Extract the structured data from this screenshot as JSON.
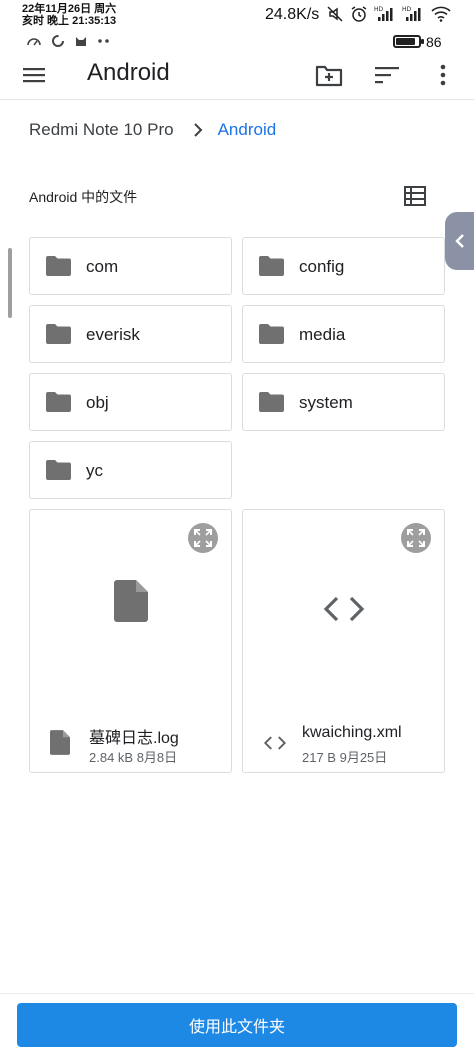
{
  "status_bar": {
    "date_line": "22年11月26日 周六",
    "time_line": "亥时 晚上 21:35:13",
    "net_speed": "24.8K/s",
    "battery_pct": "86",
    "battery_level": 0.86
  },
  "app_bar": {
    "title": "Android"
  },
  "breadcrumb": {
    "root": "Redmi Note 10 Pro",
    "current": "Android"
  },
  "section": {
    "title": "Android 中的文件"
  },
  "folders": [
    {
      "name": "com"
    },
    {
      "name": "config"
    },
    {
      "name": "everisk"
    },
    {
      "name": "media"
    },
    {
      "name": "obj"
    },
    {
      "name": "system"
    },
    {
      "name": "yc"
    }
  ],
  "files": [
    {
      "name": "墓碑日志.log",
      "info": "2.84 kB 8月8日",
      "icon": "document-icon"
    },
    {
      "name": "kwaiching.xml",
      "info": "217 B 9月25日",
      "icon": "code-icon"
    }
  ],
  "bottom": {
    "button_label": "使用此文件夹"
  },
  "colors": {
    "accent": "#1e88e5",
    "link": "#1a73e8",
    "icon_grey": "#707070"
  }
}
